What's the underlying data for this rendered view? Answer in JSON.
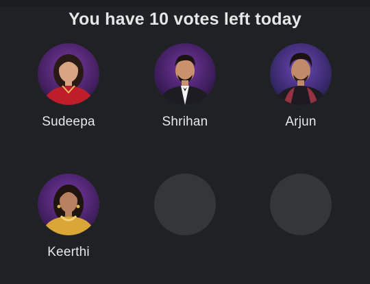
{
  "header": {
    "title": "You have 10 votes left today"
  },
  "contestants": [
    {
      "name": "Sudeepa",
      "avatar_icon": "contestant-photo-sudeepa",
      "outfit_color": "#c01d2a"
    },
    {
      "name": "Shrihan",
      "avatar_icon": "contestant-photo-shrihan",
      "outfit_color": "#1c1c22"
    },
    {
      "name": "Arjun",
      "avatar_icon": "contestant-photo-arjun",
      "outfit_color": "#1e1a22"
    },
    {
      "name": "Keerthi",
      "avatar_icon": "contestant-photo-keerthi",
      "outfit_color": "#d9a637"
    }
  ],
  "colors": {
    "background": "#1f2124",
    "empty_slot": "#33373a",
    "text": "#e6e6e6",
    "avatar_backdrop": "#5a2a8c"
  }
}
